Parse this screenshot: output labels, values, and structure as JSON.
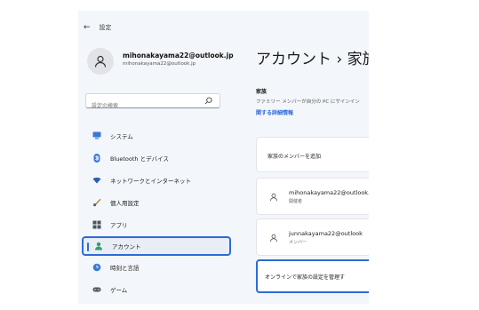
{
  "window": {
    "title": "設定"
  },
  "profile": {
    "email": "mihonakayama22@outlook.jp",
    "subtitle": "mihonakayama22@outlook.jp"
  },
  "search": {
    "placeholder": "設定の検索"
  },
  "sidebar": {
    "items": [
      {
        "label": "システム",
        "icon": "monitor-icon"
      },
      {
        "label": "Bluetooth とデバイス",
        "icon": "bluetooth-icon"
      },
      {
        "label": "ネットワークとインターネット",
        "icon": "wifi-icon"
      },
      {
        "label": "個人用設定",
        "icon": "brush-icon"
      },
      {
        "label": "アプリ",
        "icon": "apps-icon"
      },
      {
        "label": "アカウント",
        "icon": "person-icon",
        "selected": true
      },
      {
        "label": "時刻と言語",
        "icon": "globe-clock-icon"
      },
      {
        "label": "ゲーム",
        "icon": "gamepad-icon"
      }
    ]
  },
  "main": {
    "title": "アカウント  ›  家族",
    "section_title": "家族",
    "section_desc": "ファミリー メンバーが自分の PC にサインイン",
    "section_link": "関する詳細情報",
    "add_member": "家族のメンバーを追加",
    "members": [
      {
        "email": "mihonakayama22@outlook.",
        "role": "開催者"
      },
      {
        "email": "junnakayama22@outlook",
        "role": "メンバー"
      }
    ],
    "online_settings": "オンラインで家族の設定を管理す"
  },
  "colors": {
    "accent": "#2d6bd6",
    "background": "#f3f6fb"
  }
}
